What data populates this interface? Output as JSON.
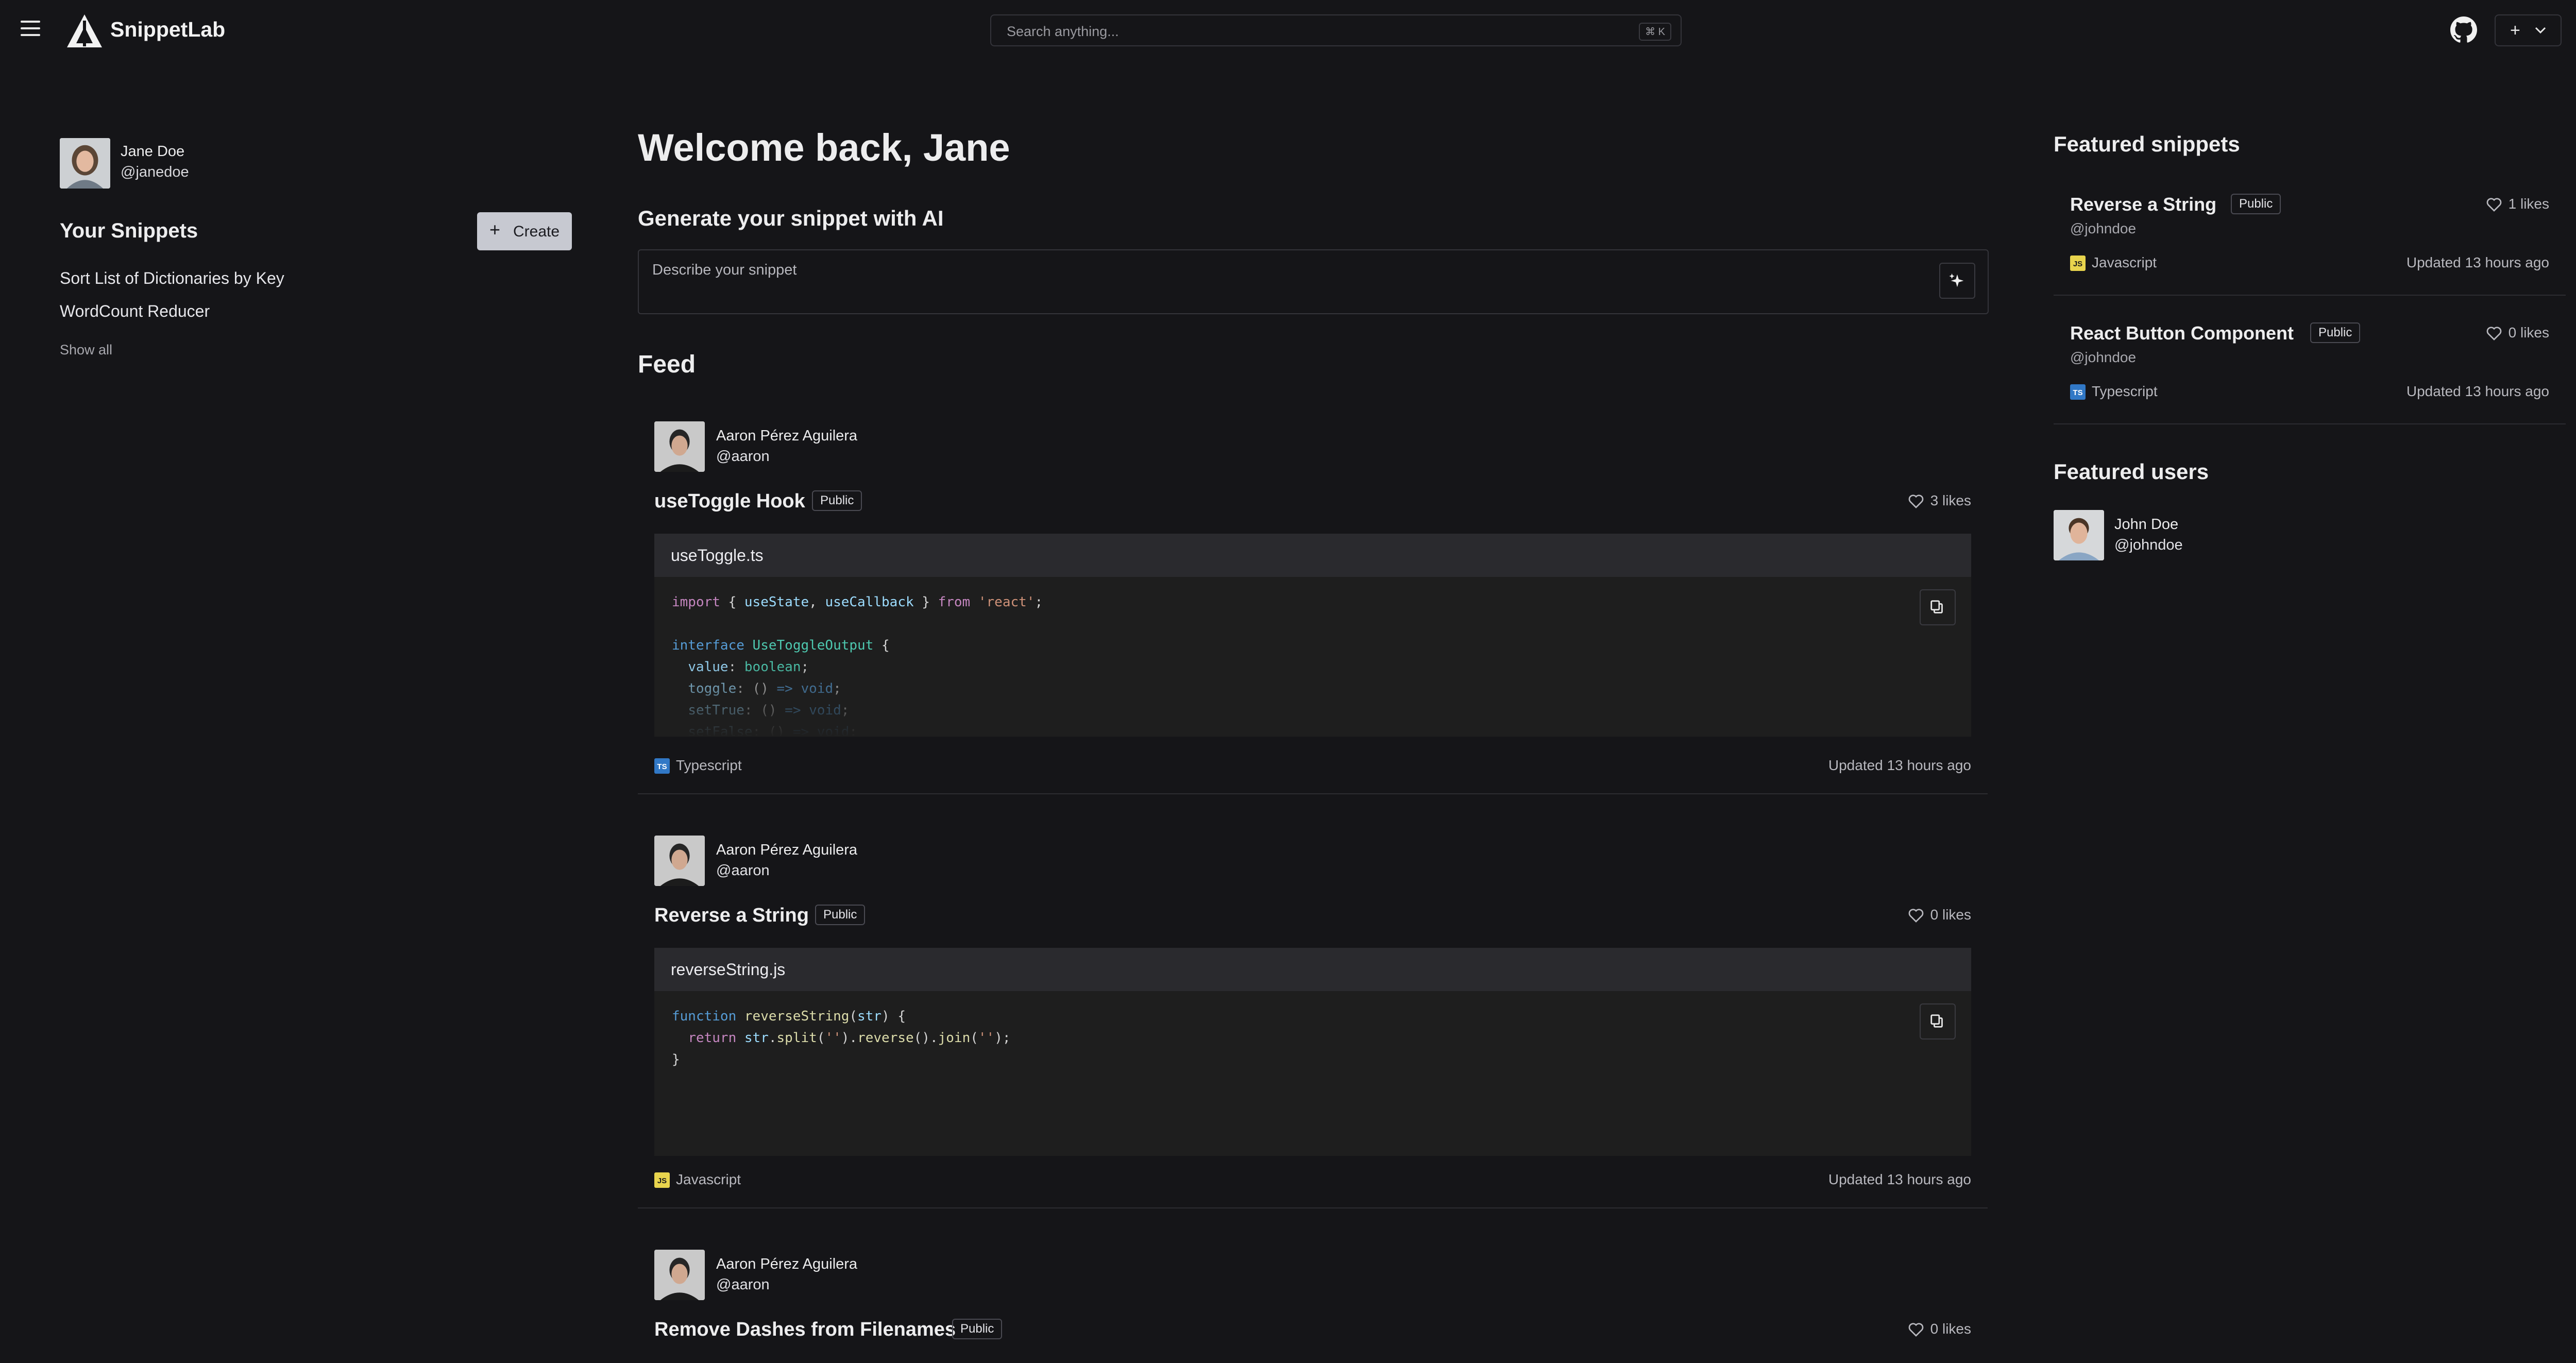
{
  "app": {
    "name": "SnippetLab"
  },
  "search": {
    "placeholder": "Search anything...",
    "shortcut": "⌘ K"
  },
  "header": {
    "new_label": "+"
  },
  "sidebar": {
    "user": {
      "name": "Jane Doe",
      "handle": "@janedoe"
    },
    "title": "Your Snippets",
    "create_label": "Create",
    "snippets": [
      "Sort List of Dictionaries by Key",
      "WordCount Reducer"
    ],
    "show_all": "Show all"
  },
  "main": {
    "welcome": "Welcome back, Jane",
    "ai_title": "Generate your snippet with AI",
    "ai_placeholder": "Describe your snippet",
    "feed_title": "Feed"
  },
  "feed": [
    {
      "author": "Aaron Pérez Aguilera",
      "handle": "@aaron",
      "title": "useToggle Hook",
      "visibility": "Public",
      "likes": "3 likes",
      "file": "useToggle.ts",
      "language": "Typescript",
      "updated": "Updated 13 hours ago"
    },
    {
      "author": "Aaron Pérez Aguilera",
      "handle": "@aaron",
      "title": "Reverse a String",
      "visibility": "Public",
      "likes": "0 likes",
      "file": "reverseString.js",
      "language": "Javascript",
      "updated": "Updated 13 hours ago"
    },
    {
      "author": "Aaron Pérez Aguilera",
      "handle": "@aaron",
      "title": "Remove Dashes from Filenames",
      "visibility": "Public",
      "likes": "0 likes"
    }
  ],
  "featured": {
    "title": "Featured snippets",
    "snippets": [
      {
        "title": "Reverse a String",
        "visibility": "Public",
        "likes": "1 likes",
        "handle": "@johndoe",
        "language": "Javascript",
        "updated": "Updated 13 hours ago"
      },
      {
        "title": "React Button Component",
        "visibility": "Public",
        "likes": "0 likes",
        "handle": "@johndoe",
        "language": "Typescript",
        "updated": "Updated 13 hours ago"
      }
    ],
    "users_title": "Featured users",
    "users": [
      {
        "name": "John Doe",
        "handle": "@johndoe"
      }
    ]
  },
  "language_icons": {
    "Javascript": "JS",
    "Typescript": "TS"
  },
  "colors": {
    "background": "#151518",
    "code_bg": "#1e1e1e",
    "js": "#e8d44d",
    "ts": "#3178c6",
    "create_button": "#c7c9d1"
  }
}
